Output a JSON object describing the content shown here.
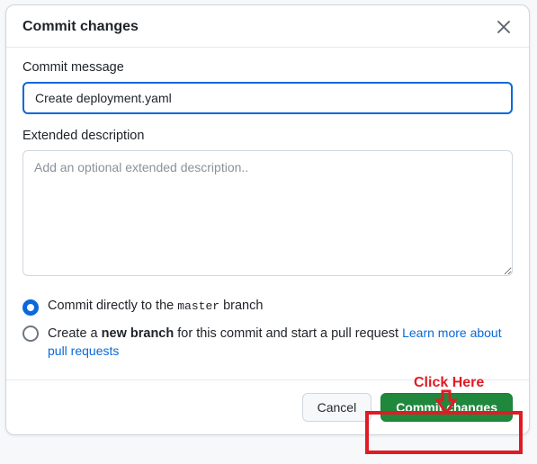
{
  "dialog": {
    "title": "Commit changes",
    "commit_message_label": "Commit message",
    "commit_message_value": "Create deployment.yaml",
    "extended_label": "Extended description",
    "extended_placeholder": "Add an optional extended description..",
    "radio_direct_prefix": "Commit directly to the ",
    "radio_direct_branch": "master",
    "radio_direct_suffix": " branch",
    "radio_newbranch_prefix": "Create a ",
    "radio_newbranch_bold": "new branch",
    "radio_newbranch_suffix": " for this commit and start a pull request ",
    "learn_link": "Learn more about pull requests",
    "cancel_label": "Cancel",
    "commit_label": "Commit changes"
  },
  "annotation": {
    "click_here": "Click Here"
  }
}
